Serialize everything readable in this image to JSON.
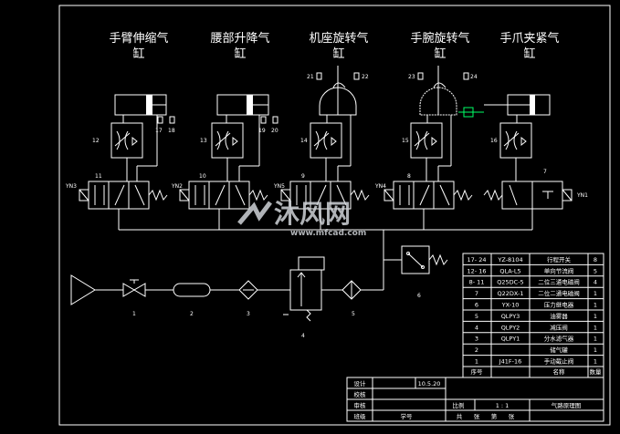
{
  "cylinders": [
    {
      "title_line1": "手臂伸缩气",
      "title_line2": "缸"
    },
    {
      "title_line1": "腰部升降气",
      "title_line2": "缸"
    },
    {
      "title_line1": "机座旋转气",
      "title_line2": "缸"
    },
    {
      "title_line1": "手腕旋转气",
      "title_line2": "缸"
    },
    {
      "title_line1": "手爪夹紧气",
      "title_line2": "缸"
    }
  ],
  "valve_tags": [
    "YN3",
    "YN2",
    "YN5",
    "YN4",
    "YN1"
  ],
  "numbers": {
    "n1": "1",
    "n2": "2",
    "n3": "3",
    "n4": "4",
    "n5": "5",
    "n6": "6",
    "n7": "7",
    "n8": "8",
    "n9": "9",
    "n10": "10",
    "n11": "11",
    "n12": "12",
    "n13": "13",
    "n14": "14",
    "n15": "15",
    "n16": "16",
    "n17": "17",
    "n18": "18",
    "n19": "19",
    "n20": "20",
    "n21": "21",
    "n22": "22",
    "n23": "23",
    "n24": "24"
  },
  "parts_table": [
    {
      "seq": "17- 24",
      "code": "YZ-8104",
      "name": "行程开关",
      "qty": "8"
    },
    {
      "seq": "12- 16",
      "code": "QLA-L5",
      "name": "单向节流阀",
      "qty": "5"
    },
    {
      "seq": "8- 11",
      "code": "Q25DC-5",
      "name": "二位三通电磁阀",
      "qty": "4"
    },
    {
      "seq": "7",
      "code": "Q22DX-1",
      "name": "二位二通电磁阀",
      "qty": "1"
    },
    {
      "seq": "6",
      "code": "YX-10",
      "name": "压力继电器",
      "qty": "1"
    },
    {
      "seq": "5",
      "code": "QLPY3",
      "name": "油雾器",
      "qty": "1"
    },
    {
      "seq": "4",
      "code": "QLPY2",
      "name": "减压阀",
      "qty": "1"
    },
    {
      "seq": "3",
      "code": "QLPY1",
      "name": "分水滤气器",
      "qty": "1"
    },
    {
      "seq": "2",
      "code": "",
      "name": "储气罐",
      "qty": "1"
    },
    {
      "seq": "1",
      "code": "J41F-16",
      "name": "手动截止阀",
      "qty": "1"
    }
  ],
  "table_header": {
    "seq": "序号",
    "name": "名称",
    "qty": "数量"
  },
  "title_block": {
    "design_label": "设计",
    "design_date": "10.5.20",
    "check_label": "校核",
    "review_label": "审核",
    "class_label": "班级",
    "student_no_label": "学号",
    "scale_label": "比例",
    "scale_value": "1 : 1",
    "drawing_name": "气路原理图",
    "sheets_total": "共",
    "sheets_word": "张",
    "sheet_no": "第",
    "sheet_word": "张"
  },
  "watermark": {
    "brand": "沐风网",
    "url": "www.mfcad.com"
  },
  "colors": {
    "background": "#000000",
    "lines": "#ffffff",
    "highlight": "#00ff66"
  }
}
